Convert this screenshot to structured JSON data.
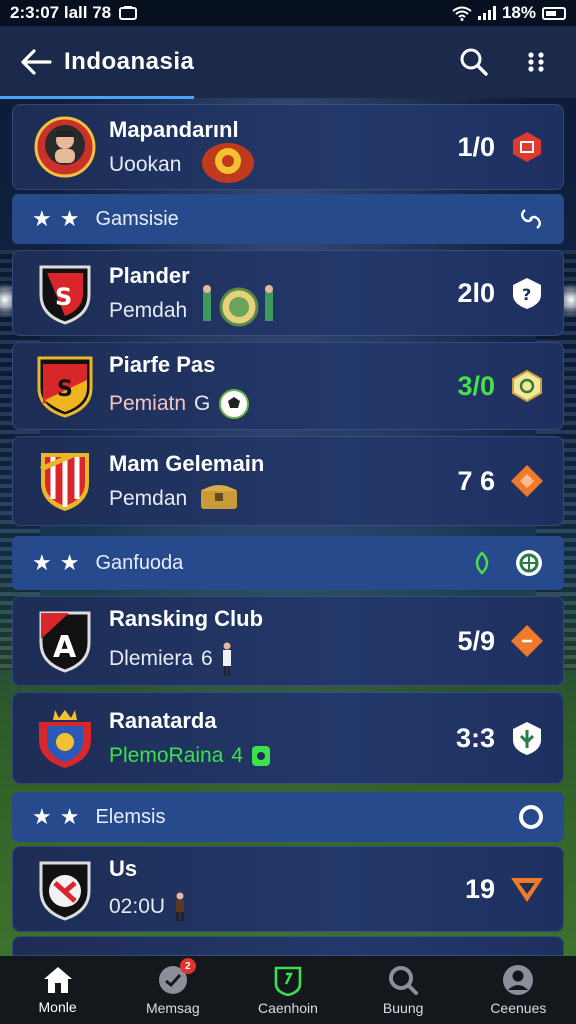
{
  "status_bar": {
    "time": "2:3:07 lall 78",
    "battery": "18%"
  },
  "header": {
    "title": "Indoanasia"
  },
  "rows": [
    {
      "name": "Mapandarınl",
      "sub": "Uookan",
      "score": "1/0"
    },
    {
      "section": "Gamsisie"
    },
    {
      "name": "Plander",
      "sub": "Pemdah",
      "score": "2l0"
    },
    {
      "name": "Piarfe Pas",
      "sub": "Pemiatn",
      "sub_extra": "G",
      "score": "3/0"
    },
    {
      "name": "Mam Gelemain",
      "sub": "Pemdan",
      "score": "7 6"
    },
    {
      "section": "Ganfuoda"
    },
    {
      "name": "Ransking Club",
      "sub": "Dlemiera",
      "sub_extra": "6",
      "score": "5/9"
    },
    {
      "name": "Ranatarda",
      "sub": "PlemoRaina",
      "sub_extra": "4",
      "score": "3:3"
    },
    {
      "section": "Elemsis"
    },
    {
      "name": "Us",
      "sub": "02:0U",
      "score": "19"
    }
  ],
  "colors": {
    "accent": "#4aa3ff",
    "green": "#48e04a",
    "orange": "#f07a2a",
    "red_badge": "#e0322f",
    "card_bg": "#1d2d55",
    "section_bg": "#274a8c"
  },
  "bottom_nav": [
    {
      "label": "Monle",
      "icon": "home-icon",
      "active": true
    },
    {
      "label": "Memsag",
      "icon": "message-icon",
      "badge": "2"
    },
    {
      "label": "Caenhoin",
      "icon": "shield-icon"
    },
    {
      "label": "Buung",
      "icon": "search-icon"
    },
    {
      "label": "Ceenues",
      "icon": "profile-icon"
    }
  ]
}
